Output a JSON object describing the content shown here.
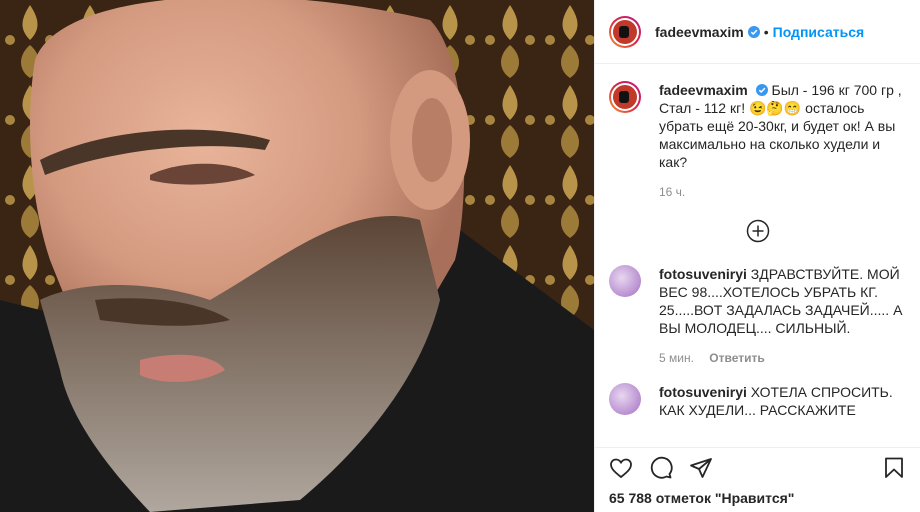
{
  "header": {
    "username": "fadeevmaxim",
    "separator": "•",
    "follow_label": "Подписаться"
  },
  "caption": {
    "username": "fadeevmaxim",
    "text": "Был - 196 кг 700 гр , Стал - 112 кг! 😉🤔😁 осталось убрать ещё 20-30кг, и будет ок! А вы максимально на сколько худели и как?",
    "time": "16 ч."
  },
  "comments": [
    {
      "username": "fotosuveniryi",
      "text": "ЗДРАВСТВУЙТЕ. МОЙ ВЕС 98....ХОТЕЛОСЬ УБРАТЬ КГ. 25.....ВОТ ЗАДАЛАСЬ ЗАДАЧЕЙ..... А ВЫ МОЛОДЕЦ.... СИЛЬНЫЙ.",
      "time": "5 мин.",
      "reply_label": "Ответить"
    },
    {
      "username": "fotosuveniryi",
      "text": "ХОТЕЛА СПРОСИТЬ. КАК ХУДЕЛИ... РАССКАЖИТЕ"
    }
  ],
  "footer": {
    "likes": "65 788 отметок \"Нравится\""
  },
  "icons": {
    "like": "heart-icon",
    "comment": "comment-icon",
    "share": "share-icon",
    "save": "bookmark-icon",
    "load_more": "plus-circle-icon",
    "verified": "verified-badge-icon"
  },
  "colors": {
    "accent": "#0095f6",
    "verified": "#3897f0",
    "muted": "#8e8e8e"
  }
}
